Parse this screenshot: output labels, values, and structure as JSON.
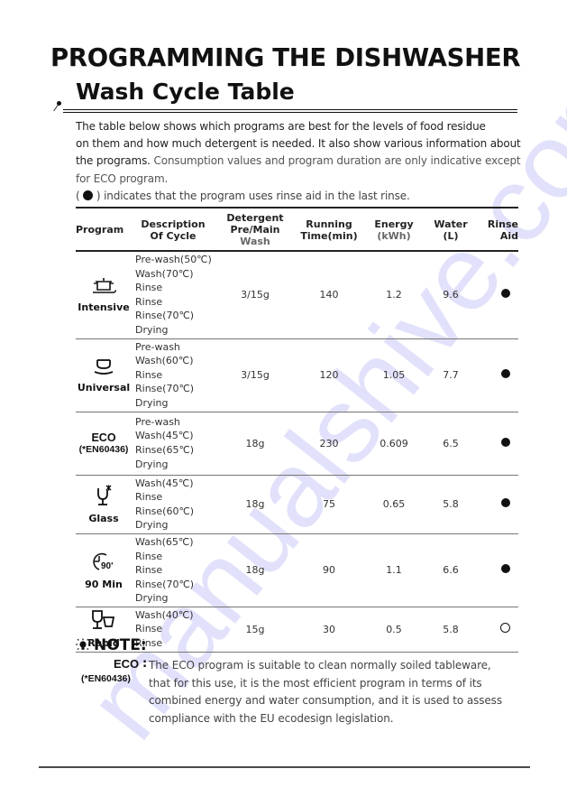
{
  "header": {
    "title": "PROGRAMMING THE DISHWASHER",
    "section_title": "Wash Cycle Table"
  },
  "intro": {
    "line1": "The table below shows which programs are best for the levels of food residue",
    "line2": "on them and how much detergent is needed. It also show various information about",
    "line3_dark": "the programs.",
    "line3_light": " Consumption values and program duration are only indicative except",
    "line4": "for ECO program.",
    "legend_open": "(",
    "legend_text": ") indicates that the program uses rinse aid in the last rinse."
  },
  "table": {
    "headers": {
      "program": "Program",
      "description_1": "Description",
      "description_2": "Of Cycle",
      "detergent_1": "Detergent",
      "detergent_2a": "Pre/Main",
      "detergent_2b": " Wash",
      "time_1": "Running",
      "time_2": "Time(min)",
      "energy_1": "Energy",
      "energy_2": "(kWh)",
      "water_1": "Water",
      "water_2": "(L)",
      "rinse_1": "Rinse",
      "rinse_2": "Aid"
    },
    "rows": [
      {
        "icon": "pot-icon",
        "name": "Intensive",
        "steps": [
          "Pre-wash(50℃)",
          "Wash(70℃)",
          "Rinse",
          "Rinse",
          "Rinse(70℃)",
          "Drying"
        ],
        "detergent": "3/15g",
        "time": "140",
        "energy": "1.2",
        "water": "9.6",
        "rinse_aid": true
      },
      {
        "icon": "bowl-icon",
        "name": "Universal",
        "steps": [
          "Pre-wash",
          "Wash(60℃)",
          "Rinse",
          "Rinse(70℃)",
          "Drying"
        ],
        "detergent": "3/15g",
        "time": "120",
        "energy": "1.05",
        "water": "7.7",
        "rinse_aid": true
      },
      {
        "icon": "",
        "name": "ECO",
        "standard": "(*EN60436)",
        "steps": [
          "Pre-wash",
          "Wash(45℃)",
          "Rinse(65℃)",
          "Drying"
        ],
        "detergent": "18g",
        "time": "230",
        "energy": "0.609",
        "water": "6.5",
        "rinse_aid": true
      },
      {
        "icon": "glass-icon",
        "name": "Glass",
        "steps": [
          "Wash(45℃)",
          "Rinse",
          "Rinse(60℃)",
          "Drying"
        ],
        "detergent": "18g",
        "time": "75",
        "energy": "0.65",
        "water": "5.8",
        "rinse_aid": true
      },
      {
        "icon": "clock-90-icon",
        "icon_label": "90'",
        "name": "90 Min",
        "steps": [
          "Wash(65℃)",
          "Rinse",
          "Rinse",
          "Rinse(70℃)",
          "Drying"
        ],
        "detergent": "18g",
        "time": "90",
        "energy": "1.1",
        "water": "6.6",
        "rinse_aid": true
      },
      {
        "icon": "rapid-glasses-icon",
        "name": "Rapid",
        "steps": [
          "Wash(40℃)",
          "Rinse",
          "Rinse"
        ],
        "detergent": "15g",
        "time": "30",
        "energy": "0.5",
        "water": "5.8",
        "rinse_aid": false
      }
    ]
  },
  "note": {
    "title": "NOTE:",
    "icon": "lightbulb-icon",
    "label": "ECO",
    "standard": "(*EN60436)",
    "colon": ":",
    "text": "The ECO program is suitable to clean normally soiled tableware, that for this use, it is the most efficient program in terms of its combined energy and water consumption, and it is used to assess compliance with the EU ecodesign legislation."
  },
  "watermark": "manualshive.com"
}
